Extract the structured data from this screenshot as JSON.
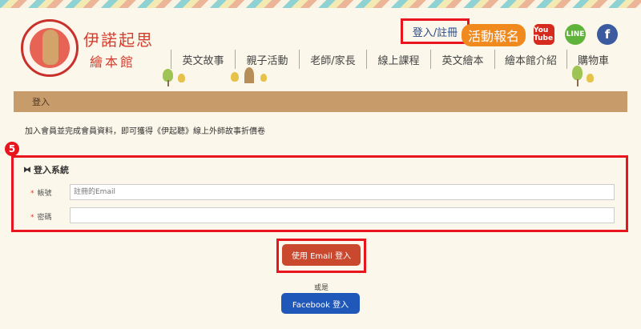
{
  "brand": {
    "title": "伊諾起思",
    "subtitle": "繪本館"
  },
  "header": {
    "login_link": "登入/註冊",
    "event_button": "活動報名",
    "social": {
      "youtube": "You Tube",
      "line": "LINE",
      "facebook": "f"
    }
  },
  "nav": [
    "英文故事",
    "親子活動",
    "老師/家長",
    "線上課程",
    "英文繪本",
    "繪本館介紹",
    "購物車"
  ],
  "breadcrumb": "登入",
  "notice": "加入會員並完成會員資料，即可獲得《伊起聽》線上外師故事折價卷",
  "annotation_badge": "5",
  "login_form": {
    "title": "登入系統",
    "account_label": "帳號",
    "account_placeholder": "註冊的Email",
    "account_value": "",
    "password_label": "密碼",
    "password_value": "",
    "required_mark": "*"
  },
  "email_login_button": "使用 Email 登入",
  "or_text": "或是",
  "facebook_login_button": "Facebook 登入",
  "colors": {
    "accent_red": "#e8141e",
    "event_orange": "#f08a1e",
    "breadcrumb_tan": "#c79b6a",
    "facebook_blue": "#1f58b8",
    "email_button": "#c9482e"
  }
}
